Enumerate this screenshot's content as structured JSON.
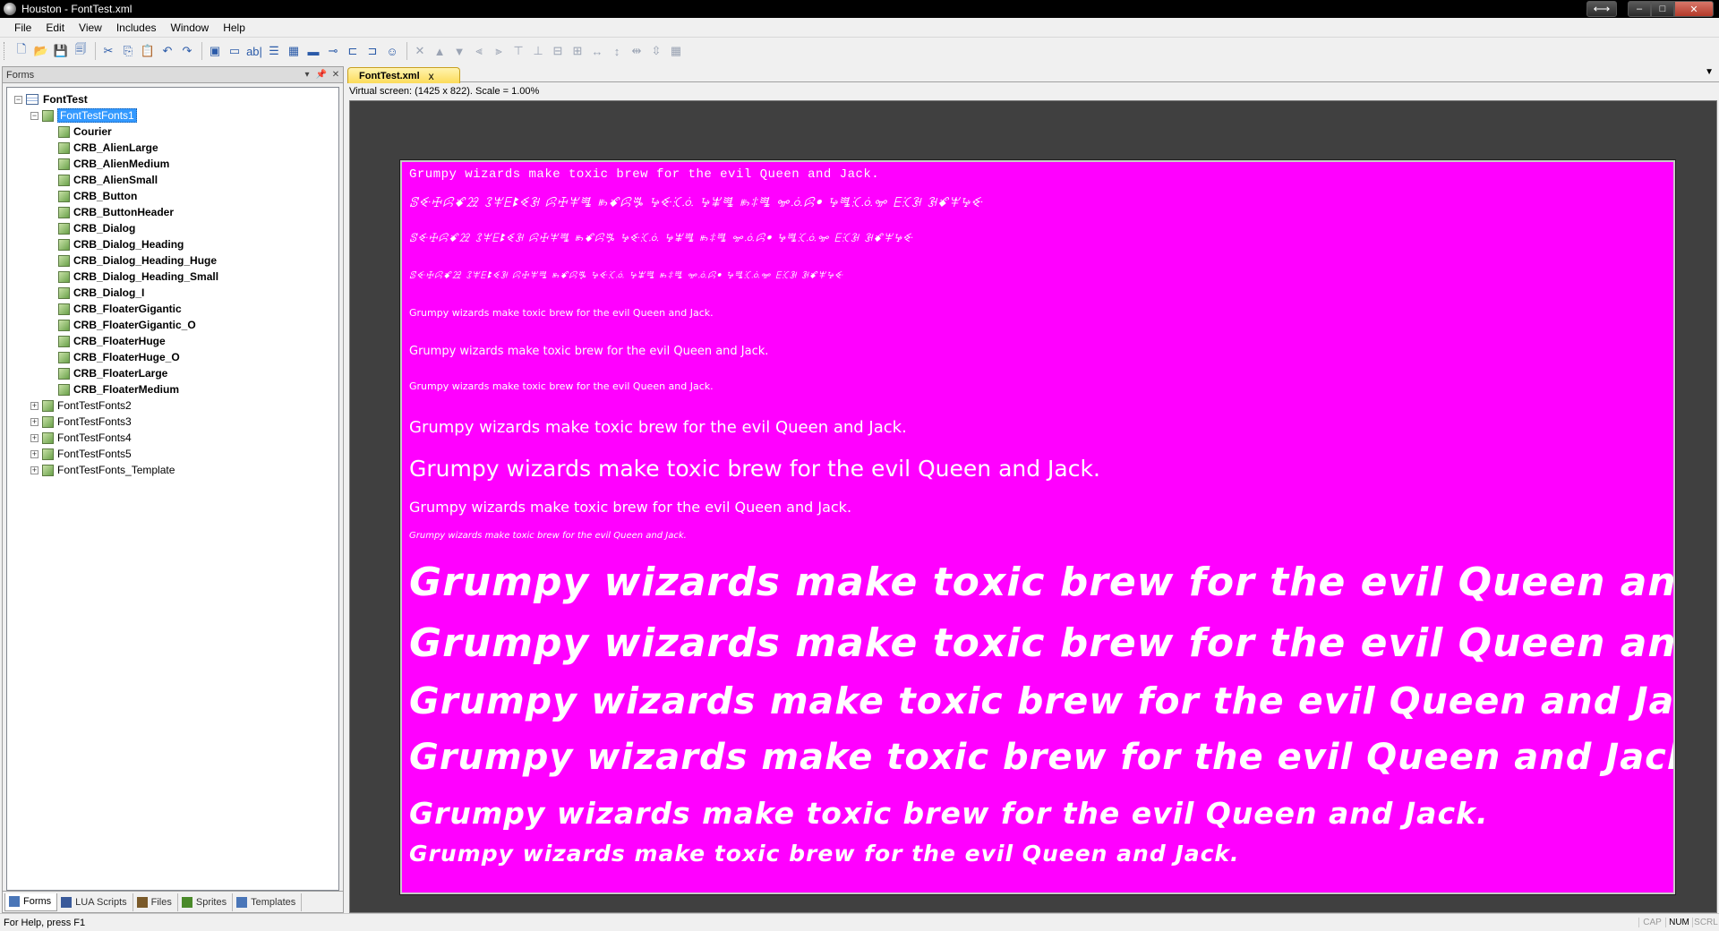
{
  "window": {
    "title": "Houston - FontTest.xml",
    "controls": {
      "expand": "⟷",
      "minimize": "–",
      "maximize": "□",
      "close": "✕"
    }
  },
  "menu": [
    "File",
    "Edit",
    "View",
    "Includes",
    "Window",
    "Help"
  ],
  "toolbar": {
    "icons": [
      "new-icon",
      "open-icon",
      "save-icon",
      "save-all-icon",
      "cut-icon",
      "copy-icon",
      "paste-icon",
      "undo-icon",
      "redo-icon",
      "form-icon",
      "button-icon",
      "label-icon",
      "listbox-icon",
      "grid-icon",
      "edit-icon",
      "slider-icon",
      "tree-icon",
      "checkbox-icon",
      "smiley-icon",
      "delete-icon",
      "move-up-icon",
      "move-down-icon",
      "align-left-icon",
      "align-right-icon",
      "align-top-icon",
      "align-bottom-icon",
      "center-h-icon",
      "center-v-icon",
      "same-width-icon",
      "same-height-icon",
      "space-across-icon",
      "space-down-icon",
      "grid-toggle-icon"
    ],
    "glyphs": [
      "🗋",
      "📂",
      "💾",
      "🗐",
      "✂",
      "⎘",
      "📋",
      "↶",
      "↷",
      "▣",
      "▭",
      "ab|",
      "☰",
      "▦",
      "▬",
      "⊸",
      "⊏",
      "⊐",
      "☺",
      "✕",
      "▲",
      "▼",
      "⫷",
      "⫸",
      "⊤",
      "⊥",
      "⊟",
      "⊞",
      "↔",
      "↕",
      "⇹",
      "⇳",
      "▦"
    ]
  },
  "forms_panel": {
    "title": "Forms",
    "header_buttons": [
      "▾",
      "📌",
      "✕"
    ],
    "tree": [
      {
        "label": "FontTest",
        "level": 0,
        "expander": "−",
        "icon": "form",
        "bold": true
      },
      {
        "label": "FontTestFonts1",
        "level": 1,
        "expander": "−",
        "icon": "node",
        "selected": true
      },
      {
        "label": "Courier",
        "level": 2,
        "icon": "node",
        "bold": true
      },
      {
        "label": "CRB_AlienLarge",
        "level": 2,
        "icon": "node",
        "bold": true
      },
      {
        "label": "CRB_AlienMedium",
        "level": 2,
        "icon": "node",
        "bold": true
      },
      {
        "label": "CRB_AlienSmall",
        "level": 2,
        "icon": "node",
        "bold": true
      },
      {
        "label": "CRB_Button",
        "level": 2,
        "icon": "node",
        "bold": true
      },
      {
        "label": "CRB_ButtonHeader",
        "level": 2,
        "icon": "node",
        "bold": true
      },
      {
        "label": "CRB_Dialog",
        "level": 2,
        "icon": "node",
        "bold": true
      },
      {
        "label": "CRB_Dialog_Heading",
        "level": 2,
        "icon": "node",
        "bold": true
      },
      {
        "label": "CRB_Dialog_Heading_Huge",
        "level": 2,
        "icon": "node",
        "bold": true
      },
      {
        "label": "CRB_Dialog_Heading_Small",
        "level": 2,
        "icon": "node",
        "bold": true
      },
      {
        "label": "CRB_Dialog_I",
        "level": 2,
        "icon": "node",
        "bold": true
      },
      {
        "label": "CRB_FloaterGigantic",
        "level": 2,
        "icon": "node",
        "bold": true
      },
      {
        "label": "CRB_FloaterGigantic_O",
        "level": 2,
        "icon": "node",
        "bold": true
      },
      {
        "label": "CRB_FloaterHuge",
        "level": 2,
        "icon": "node",
        "bold": true
      },
      {
        "label": "CRB_FloaterHuge_O",
        "level": 2,
        "icon": "node",
        "bold": true
      },
      {
        "label": "CRB_FloaterLarge",
        "level": 2,
        "icon": "node",
        "bold": true
      },
      {
        "label": "CRB_FloaterMedium",
        "level": 2,
        "icon": "node",
        "bold": true
      },
      {
        "label": "FontTestFonts2",
        "level": 1,
        "expander": "+",
        "icon": "node"
      },
      {
        "label": "FontTestFonts3",
        "level": 1,
        "expander": "+",
        "icon": "node"
      },
      {
        "label": "FontTestFonts4",
        "level": 1,
        "expander": "+",
        "icon": "node"
      },
      {
        "label": "FontTestFonts5",
        "level": 1,
        "expander": "+",
        "icon": "node"
      },
      {
        "label": "FontTestFonts_Template",
        "level": 1,
        "expander": "+",
        "icon": "node"
      }
    ],
    "tabs": [
      {
        "label": "Forms",
        "active": true
      },
      {
        "label": "LUA Scripts"
      },
      {
        "label": "Files"
      },
      {
        "label": "Sprites"
      },
      {
        "label": "Templates"
      }
    ]
  },
  "document": {
    "tab_label": "FontTest.xml",
    "tab_close": "x",
    "tab_menu": "▼",
    "virtual_info": "Virtual screen: (1425 x 822). Scale = 1.00%",
    "surface_color": "#ff00ff",
    "samples": [
      {
        "text": "Grumpy wizards make toxic brew for the evil Queen and Jack.",
        "font": "Courier"
      },
      {
        "text": "ꕷꔾꖅꕸꗄꗠ ꕘꕽꗋꔪꔽꘂ ꕸꖅꕽꗀ ꖳꗄꕸꔨ ꕵꔾꕿꗝ ꕵꕾꗀ ꖳꖋꗀ ꗁꗝꕸꔷ ꕵꗀꕿꗝꗁ ꗋꕿꘂ ꘂꗄꕽꕵꔾ",
        "font": "CRB_AlienLarge"
      },
      {
        "text": "ꕷꔾꖅꕸꗄꗠ ꕘꕽꗋꔪꔽꘂ ꕸꖅꕽꗀ ꖳꗄꕸꔨ ꕵꔾꕿꗝ ꕵꕾꗀ ꖳꖋꗀ ꗁꗝꕸꔷ ꕵꗀꕿꗝꗁ ꗋꕿꘂ ꘂꗄꕽꕵꔾ",
        "font": "CRB_AlienMedium"
      },
      {
        "text": "ꕷꔾꖅꕸꗄꗠ ꕘꕽꗋꔪꔽꘂ ꕸꖅꕽꗀ ꖳꗄꕸꔨ ꕵꔾꕿꗝ ꕵꕾꗀ ꖳꖋꗀ ꗁꗝꕸꔷ ꕵꗀꕿꗝꗁ ꗋꕿꘂ ꘂꗄꕽꕵꔾ",
        "font": "CRB_AlienSmall"
      },
      {
        "text": "Grumpy wizards make toxic brew for the evil Queen and Jack.",
        "font": "CRB_Button"
      },
      {
        "text": "Grumpy wizards make toxic brew for the evil Queen and Jack.",
        "font": "CRB_ButtonHeader"
      },
      {
        "text": "Grumpy wizards make toxic brew for the evil Queen and Jack.",
        "font": "CRB_Dialog"
      },
      {
        "text": "Grumpy wizards make toxic brew for the evil Queen and Jack.",
        "font": "CRB_Dialog_Heading"
      },
      {
        "text": "Grumpy wizards make toxic brew for the evil Queen and Jack.",
        "font": "CRB_Dialog_Heading_Huge"
      },
      {
        "text": "Grumpy wizards make toxic brew for the evil Queen and Jack.",
        "font": "CRB_Dialog_Heading_Small"
      },
      {
        "text": "Grumpy wizards make toxic brew for the evil Queen and Jack.",
        "font": "CRB_Dialog_I"
      },
      {
        "text": "Grumpy wizards make toxic brew for the evil Queen and Jack.",
        "font": "CRB_FloaterGigantic"
      },
      {
        "text": "Grumpy wizards make toxic brew for the evil Queen and Jack.",
        "font": "CRB_FloaterGigantic_O"
      },
      {
        "text": "Grumpy wizards make toxic brew for the evil Queen and Jack.",
        "font": "CRB_FloaterHuge"
      },
      {
        "text": "Grumpy wizards make toxic brew for the evil Queen and Jack.",
        "font": "CRB_FloaterHuge_O"
      },
      {
        "text": "Grumpy wizards make toxic brew for the evil Queen and Jack.",
        "font": "CRB_FloaterLarge"
      },
      {
        "text": "Grumpy wizards make toxic brew for the evil Queen and Jack.",
        "font": "CRB_FloaterMedium"
      }
    ]
  },
  "statusbar": {
    "text": "For Help, press F1",
    "indicators": [
      {
        "label": "CAP",
        "on": false
      },
      {
        "label": "NUM",
        "on": true
      },
      {
        "label": "SCRL",
        "on": false
      }
    ]
  }
}
